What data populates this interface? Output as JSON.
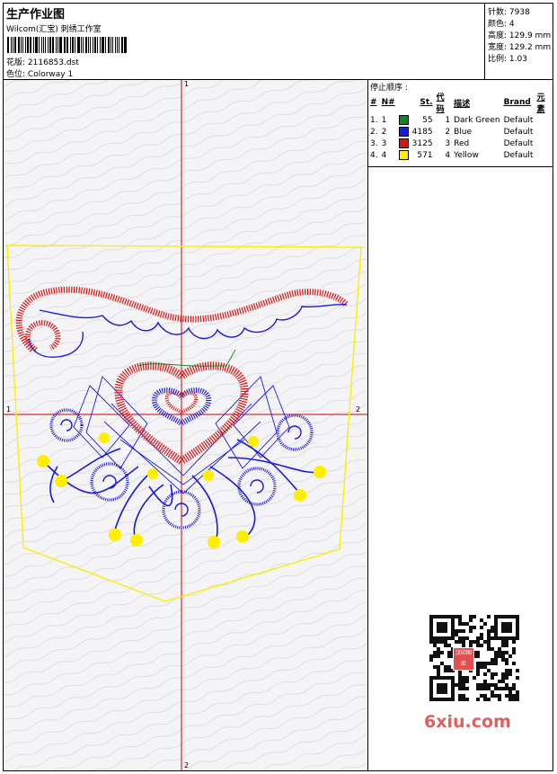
{
  "header": {
    "title": "生产作业图",
    "studio": "Wilcom(汇宝) 刺绣工作室",
    "design_label": "花版:",
    "design_value": "2116853.dst",
    "colorway_label": "色位:",
    "colorway_value": "Colorway 1"
  },
  "stats": [
    {
      "label": "针数:",
      "value": "7938"
    },
    {
      "label": "颜色:",
      "value": "4"
    },
    {
      "label": "高度:",
      "value": "129.9 mm"
    },
    {
      "label": "宽度:",
      "value": "129.2 mm"
    },
    {
      "label": "比例:",
      "value": "1.03"
    }
  ],
  "stop_sequence": {
    "title": "停止顺序 :",
    "columns": [
      "#",
      "N#",
      "St.",
      "代码",
      "描述",
      "Brand",
      "元素"
    ],
    "rows": [
      {
        "num": "1.",
        "n": "1",
        "color": "#0a8a1e",
        "st": "55",
        "code": "1",
        "desc": "Dark Green",
        "brand": "Default"
      },
      {
        "num": "2.",
        "n": "2",
        "color": "#1a1adc",
        "st": "4185",
        "code": "2",
        "desc": "Blue",
        "brand": "Default"
      },
      {
        "num": "3.",
        "n": "3",
        "color": "#e01010",
        "st": "3125",
        "code": "3",
        "desc": "Red",
        "brand": "Default"
      },
      {
        "num": "4.",
        "n": "4",
        "color": "#ffee00",
        "st": "571",
        "code": "4",
        "desc": "Yellow",
        "brand": "Default"
      }
    ]
  },
  "axes": {
    "top": "1",
    "bottom": "2",
    "left": "1",
    "right": "2"
  },
  "watermark": {
    "text": "6xiu.com",
    "seal_text": "汉印图库"
  },
  "colors": {
    "red": "#e01010",
    "blue": "#1a1adc",
    "yellow": "#ffee00",
    "green": "#0a8a1e",
    "axis": "#d00000"
  }
}
